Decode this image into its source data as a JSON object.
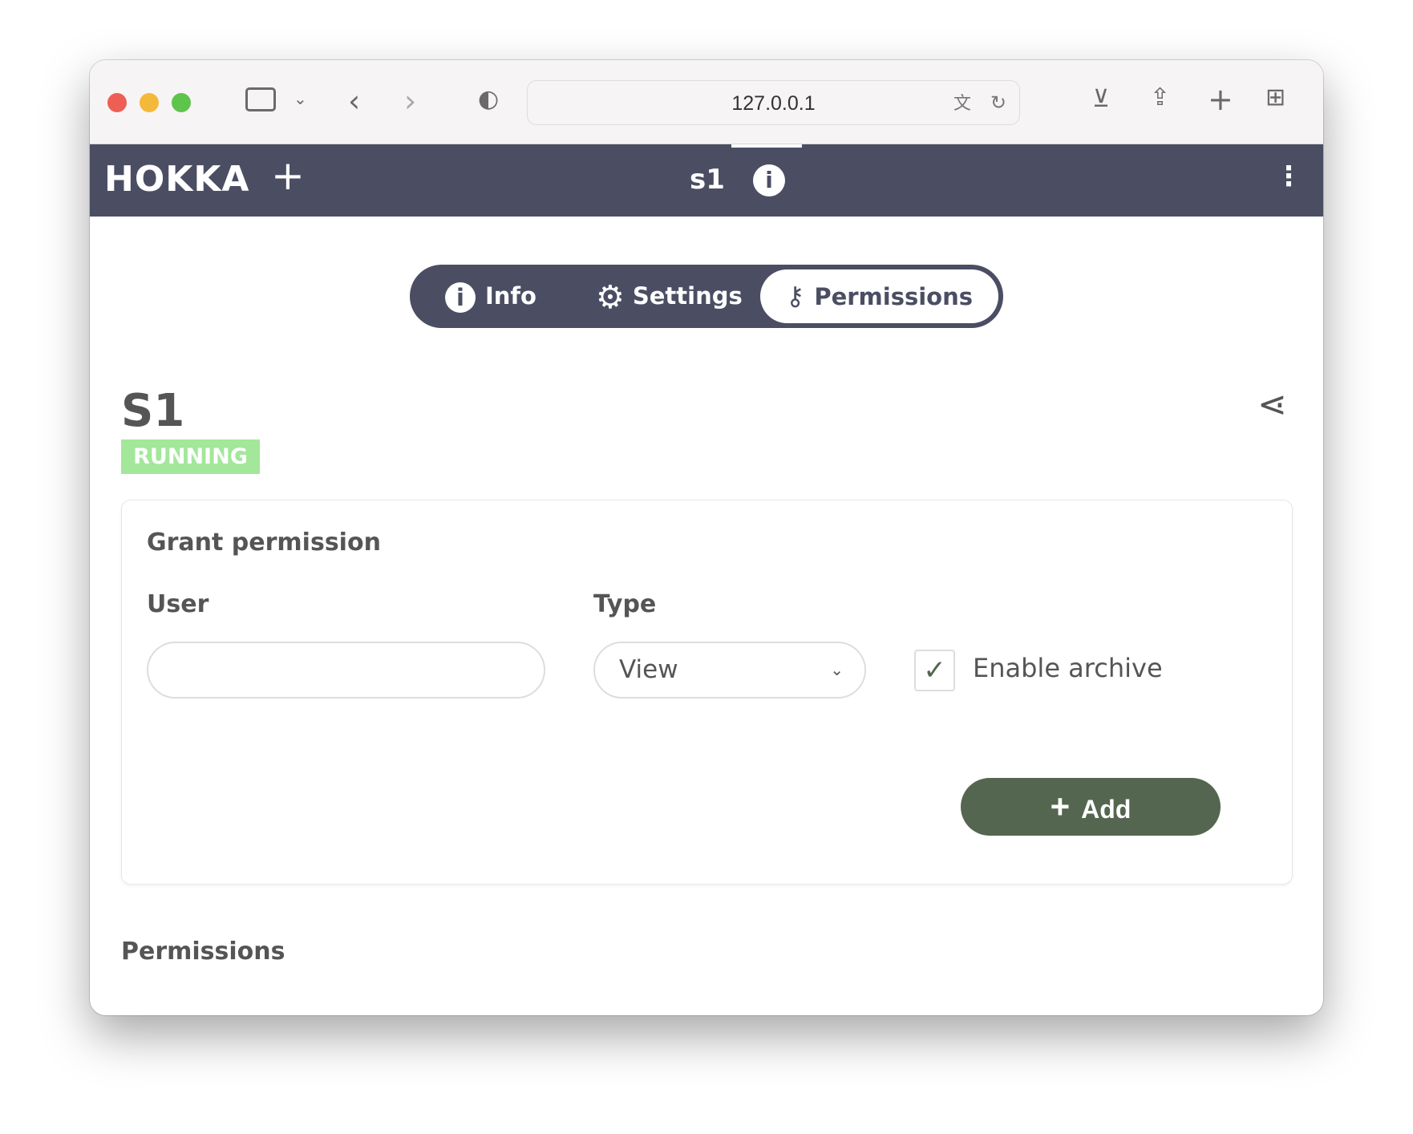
{
  "browser": {
    "url": "127.0.0.1"
  },
  "nav": {
    "logo": "HOKKA",
    "add_icon": "+",
    "title": "s1"
  },
  "tabs": [
    {
      "label": "Info",
      "icon": "info-icon"
    },
    {
      "label": "Settings",
      "icon": "gear-icon"
    },
    {
      "label": "Permissions",
      "icon": "key-icon",
      "active": true
    }
  ],
  "server": {
    "name": "S1",
    "status": "RUNNING"
  },
  "grant": {
    "heading": "Grant permission",
    "user_label": "User",
    "user_value": "",
    "type_label": "Type",
    "type_value": "View",
    "archive_label": "Enable archive",
    "archive_checked": true,
    "add_label": "Add"
  },
  "permissions": {
    "heading": "Permissions"
  },
  "colors": {
    "nav": "#4b4e63",
    "running": "#a3e79a",
    "add": "#54664f"
  }
}
